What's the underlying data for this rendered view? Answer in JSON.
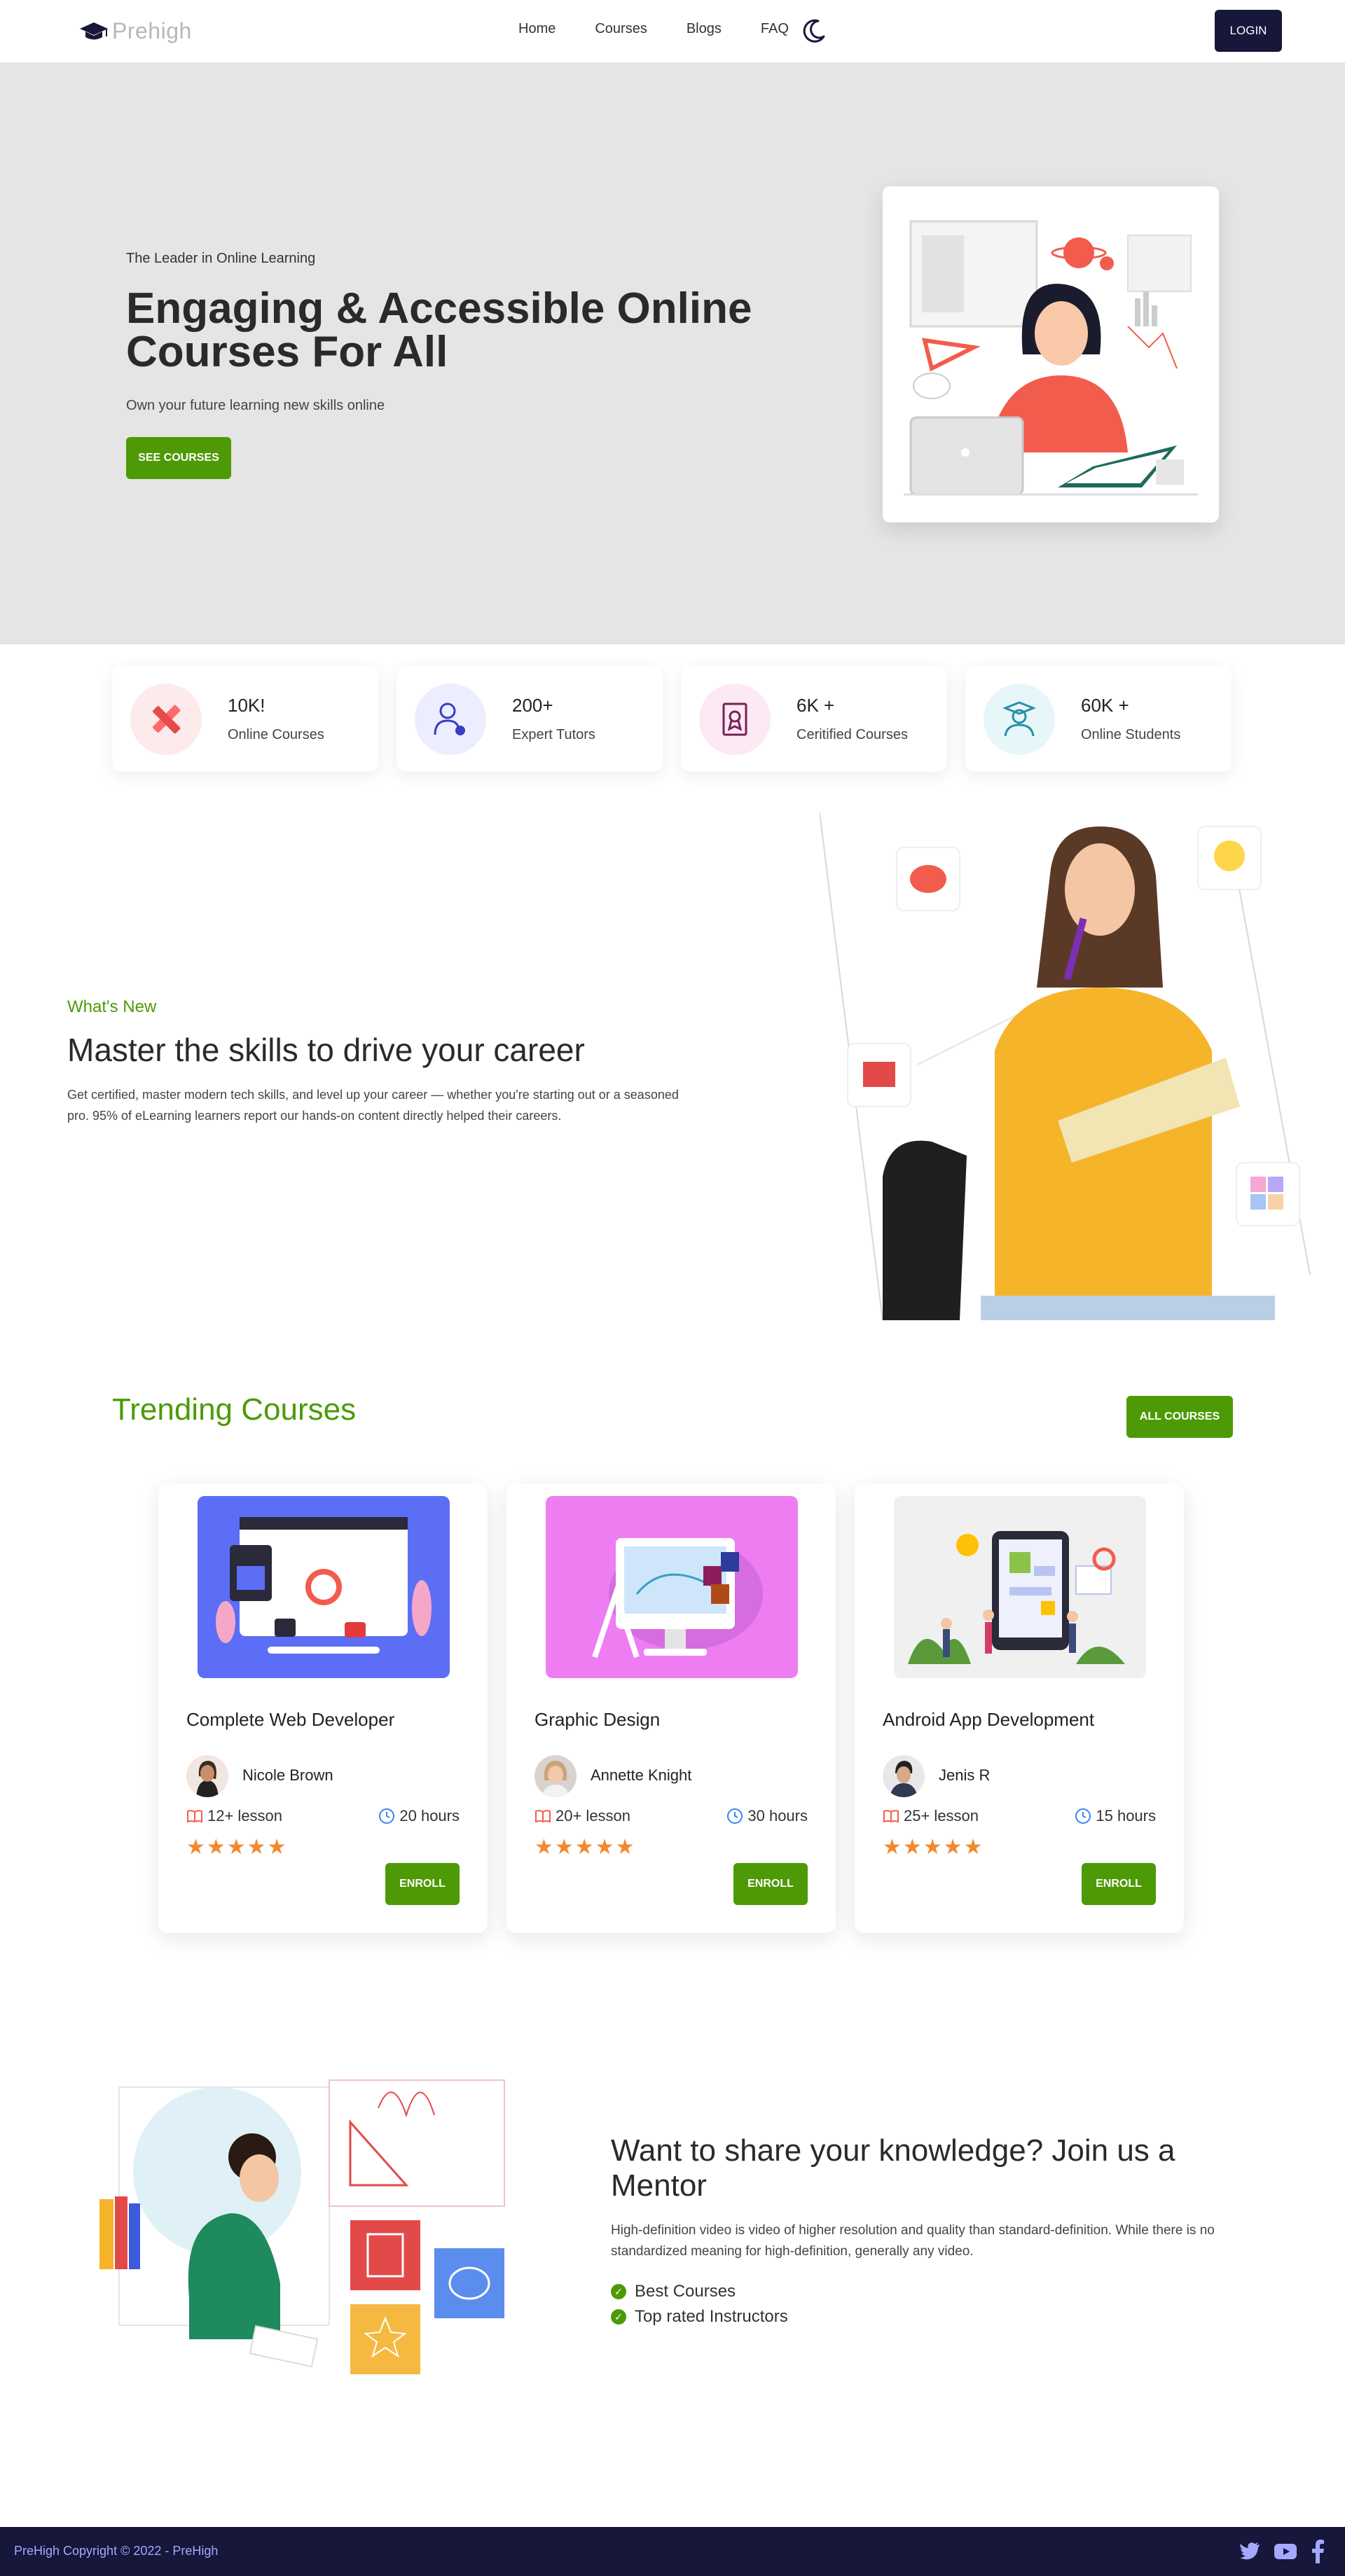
{
  "nav": {
    "brand": "Prehigh",
    "links": [
      "Home",
      "Courses",
      "Blogs",
      "FAQ"
    ],
    "login_label": "LOGIN"
  },
  "hero": {
    "eyebrow": "The Leader in Online Learning",
    "title": "Engaging & Accessible Online Courses For All",
    "subtitle": "Own your future learning new skills online",
    "cta_label": "SEE COURSES"
  },
  "stats": [
    {
      "value": "10K!",
      "label": "Online Courses",
      "icon": "pencil-ruler-icon",
      "color": "#ff6b6b"
    },
    {
      "value": "200+",
      "label": "Expert Tutors",
      "icon": "tutor-icon",
      "color": "#3c3cc8"
    },
    {
      "value": "6K +",
      "label": "Ceritified Courses",
      "icon": "certificate-icon",
      "color": "#7a1f5a"
    },
    {
      "value": "60K +",
      "label": "Online Students",
      "icon": "student-icon",
      "color": "#2a8fa8"
    }
  ],
  "whats_new": {
    "eyebrow": "What's New",
    "title": "Master the skills to drive your career",
    "text": "Get certified, master modern tech skills, and level up your career — whether you're starting out or a seasoned pro. 95% of eLearning learners report our hands-on content directly helped their careers."
  },
  "trending": {
    "title": "Trending Courses",
    "all_label": "ALL COURSES",
    "courses": [
      {
        "name": "Complete Web Developer",
        "author": "Nicole Brown",
        "lessons": "12+ lesson",
        "hours": "20 hours",
        "rating": 5,
        "enroll_label": "ENROLL"
      },
      {
        "name": "Graphic Design",
        "author": "Annette Knight",
        "lessons": "20+ lesson",
        "hours": "30 hours",
        "rating": 5,
        "enroll_label": "ENROLL"
      },
      {
        "name": "Android App Development",
        "author": "Jenis R",
        "lessons": "25+ lesson",
        "hours": "15 hours",
        "rating": 5,
        "enroll_label": "ENROLL"
      }
    ]
  },
  "mentor": {
    "title": "Want to share your knowledge? Join us a Mentor",
    "text": "High-definition video is video of higher resolution and quality than standard-definition. While there is no standardized meaning for high-definition, generally any video.",
    "items": [
      "Best Courses",
      "Top rated Instructors"
    ]
  },
  "footer": {
    "text": "PreHigh  Copyright © 2022 - PreHigh"
  },
  "colors": {
    "accent": "#4d9a06",
    "navy": "#17163b",
    "star": "#f2892e"
  }
}
